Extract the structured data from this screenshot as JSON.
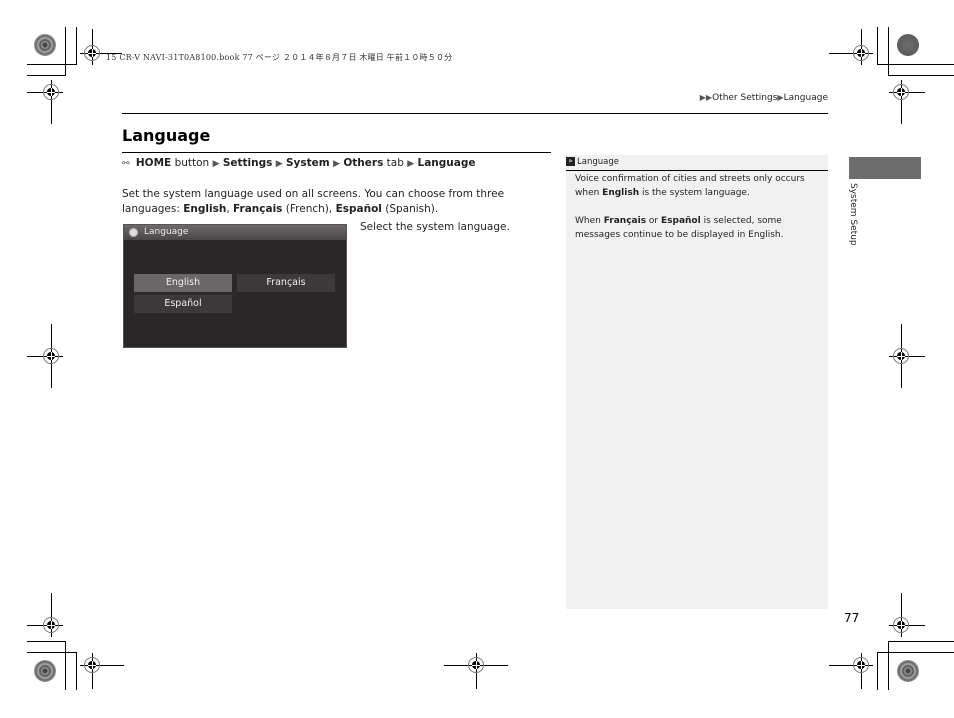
{
  "print_header": "15 CR-V NAVI-31T0A8100.book  77 ページ  ２０１４年８月７日  木曜日  午前１０時５０分",
  "running_head": {
    "arrows": "▶▶",
    "section": "Other Settings",
    "separator": "▶",
    "topic": "Language"
  },
  "title": "Language",
  "nav_path": {
    "icon": "home-button-icon",
    "steps": [
      {
        "bold": "HOME",
        "plain": " button"
      },
      {
        "bold": "Settings",
        "plain": ""
      },
      {
        "bold": "System",
        "plain": ""
      },
      {
        "bold": "Others",
        "plain": " tab"
      },
      {
        "bold": "Language",
        "plain": ""
      }
    ],
    "separator": "▶"
  },
  "body": {
    "intro": "Set the system language used on all screens. You can choose from three languages:",
    "options": [
      {
        "name": "English",
        "gloss": ""
      },
      {
        "name": "Français",
        "gloss": "(French)"
      },
      {
        "name": "Español",
        "gloss": "(Spanish)"
      }
    ]
  },
  "caption": "Select the system language.",
  "screen": {
    "title": "Language",
    "buttons": [
      {
        "label": "English",
        "selected": true
      },
      {
        "label": "Français",
        "selected": false
      },
      {
        "label": "Español",
        "selected": false
      }
    ]
  },
  "note": {
    "heading": "Language",
    "para1_a": "Voice confirmation of cities and streets only occurs when ",
    "para1_b": "English",
    "para1_c": " is the system language.",
    "para2_a": "When ",
    "para2_b": "Français",
    "para2_c": " or ",
    "para2_d": "Español",
    "para2_e": " is selected, some messages continue to be displayed in English."
  },
  "side_tab": "System Setup",
  "page_number": "77",
  "colors": {
    "side_tab": "#6d6d6d",
    "note_bg": "#f1f1f1",
    "screen_bg": "#2b2728"
  }
}
